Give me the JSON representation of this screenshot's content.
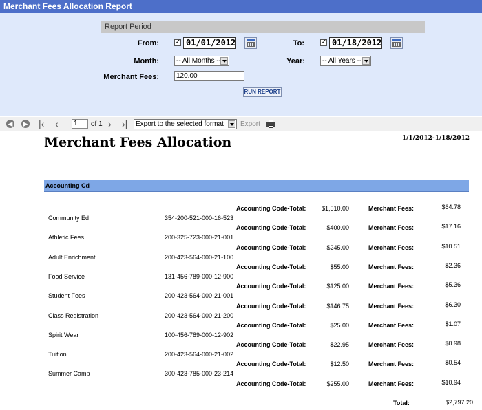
{
  "window": {
    "title": "Merchant Fees Allocation Report"
  },
  "params": {
    "section_header": "Report Period",
    "from_label": "From:",
    "from_checked": "✓",
    "from_value": "01/01/2012",
    "to_label": "To:",
    "to_checked": "✓",
    "to_value": "01/18/2012",
    "month_label": "Month:",
    "month_value": "-- All Months --",
    "year_label": "Year:",
    "year_value": "-- All Years --",
    "fee_label": "Merchant Fees:",
    "fee_value": "120.00",
    "run_label": "RUN REPORT"
  },
  "toolbar": {
    "page_value": "1",
    "page_of": "of 1",
    "export_format": "Export to the selected format",
    "export_label": "Export"
  },
  "report": {
    "title": "Merchant Fees Allocation",
    "date_range": "1/1/2012-1/18/2012",
    "group_header": "Accounting Cd",
    "total_label": "Accounting Code-Total:",
    "fee_label": "Merchant Fees:",
    "rows": [
      {
        "name": "Community Ed",
        "code": "354-200-521-000-16-523",
        "total": "$1,510.00",
        "fee": "$64.78"
      },
      {
        "name": "Athletic Fees",
        "code": "200-325-723-000-21-001",
        "total": "$400.00",
        "fee": "$17.16"
      },
      {
        "name": "Adult Enrichment",
        "code": "200-423-564-000-21-100",
        "total": "$245.00",
        "fee": "$10.51"
      },
      {
        "name": "Food Service",
        "code": "131-456-789-000-12-900",
        "total": "$55.00",
        "fee": "$2.36"
      },
      {
        "name": "Student Fees",
        "code": "200-423-564-000-21-001",
        "total": "$125.00",
        "fee": "$5.36"
      },
      {
        "name": "Class Registration",
        "code": "200-423-564-000-21-200",
        "total": "$146.75",
        "fee": "$6.30"
      },
      {
        "name": "Spirit Wear",
        "code": "100-456-789-000-12-902",
        "total": "$25.00",
        "fee": "$1.07"
      },
      {
        "name": "Tuition",
        "code": "200-423-564-000-21-002",
        "total": "$22.95",
        "fee": "$0.98"
      },
      {
        "name": "Summer Camp",
        "code": "300-423-785-000-23-214",
        "total": "$12.50",
        "fee": "$0.54"
      },
      {
        "name": "",
        "code": "",
        "total": "$255.00",
        "fee": "$10.94"
      }
    ],
    "grand_total_label": "Total:",
    "grand_total_value": "$2,797.20"
  }
}
